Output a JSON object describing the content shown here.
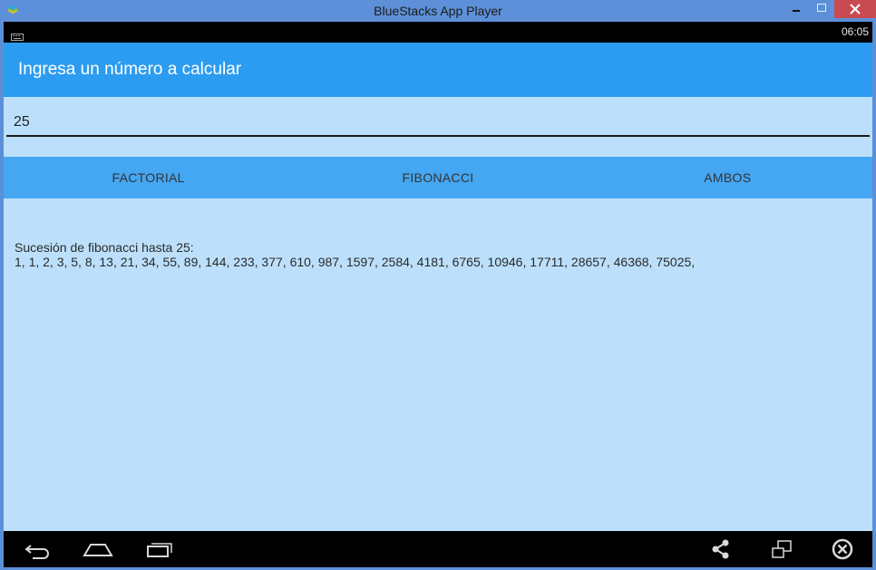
{
  "window": {
    "title": "BlueStacks App Player"
  },
  "statusbar": {
    "time": "06:05"
  },
  "actionbar": {
    "title": "Ingresa un número a calcular"
  },
  "input": {
    "value": "25"
  },
  "buttons": {
    "factorial": "FACTORIAL",
    "fibonacci": "FIBONACCI",
    "ambos": "AMBOS"
  },
  "result": {
    "heading": "Sucesión de fibonacci hasta 25:",
    "sequence": "1, 1, 2, 3, 5, 8, 13, 21, 34, 55, 89, 144, 233, 377, 610, 987, 1597, 2584, 4181, 6765, 10946, 17711, 28657, 46368, 75025,"
  },
  "colors": {
    "window_frame": "#5d90d8",
    "action_bar": "#2c9cf0",
    "button_row": "#45a6f2",
    "content_bg": "#bce0fb",
    "close_button": "#c74b50"
  },
  "icons": {
    "app_logo": "bluestacks-logo-icon",
    "minimize": "minimize-icon",
    "maximize": "maximize-icon",
    "close": "close-icon",
    "keyboard": "keyboard-icon",
    "back": "back-icon",
    "home": "home-icon",
    "recents": "recents-icon",
    "share": "share-icon",
    "window_mode": "window-mode-icon",
    "exit": "exit-icon"
  }
}
